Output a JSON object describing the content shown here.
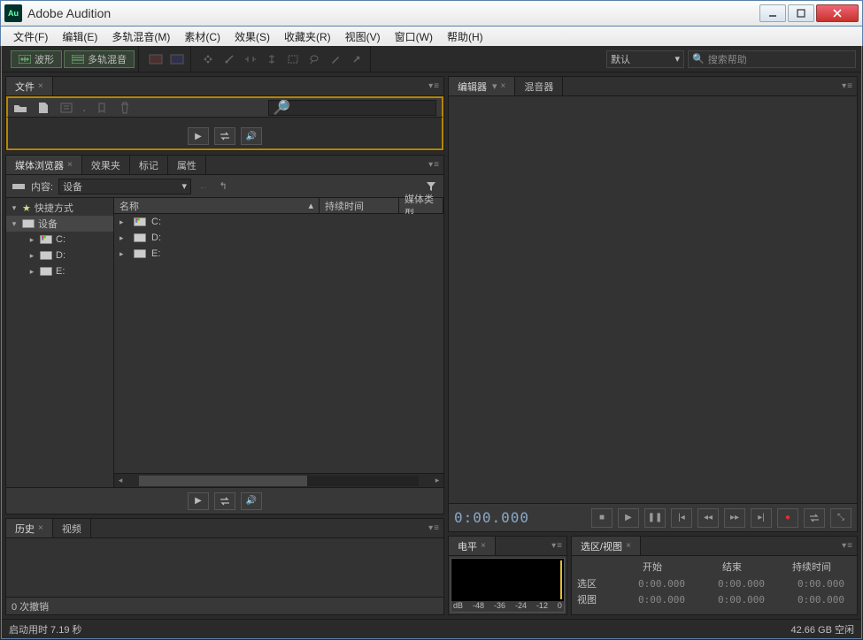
{
  "titlebar": {
    "title": "Adobe Audition",
    "icon_text": "Au"
  },
  "menu": [
    "文件(F)",
    "编辑(E)",
    "多轨混音(M)",
    "素材(C)",
    "效果(S)",
    "收藏夹(R)",
    "视图(V)",
    "窗口(W)",
    "帮助(H)"
  ],
  "toolbar": {
    "waveform": "波形",
    "multitrack": "多轨混音",
    "workspace_label": "默认",
    "search_placeholder": "搜索帮助"
  },
  "panels": {
    "files": {
      "tab": "文件"
    },
    "media": {
      "tabs": [
        "媒体浏览器",
        "效果夹",
        "标记",
        "属性"
      ],
      "content_label": "内容:",
      "content_value": "设备",
      "tree_shortcuts": "快捷方式",
      "tree_devices": "设备",
      "drives": [
        "C:",
        "D:",
        "E:"
      ],
      "columns": {
        "name": "名称",
        "duration": "持续时间",
        "type": "媒体类型"
      }
    },
    "history": {
      "tabs": [
        "历史",
        "视频"
      ],
      "undo_text": "0 次撤销"
    },
    "editor": {
      "tabs": [
        "编辑器",
        "混音器"
      ],
      "timecode": "0:00.000"
    },
    "levels": {
      "tab": "电平",
      "scale": [
        "dB",
        "-48",
        "-36",
        "-24",
        "-12",
        "0"
      ]
    },
    "selview": {
      "tab": "选区/视图",
      "cols": [
        "开始",
        "结束",
        "持续时间"
      ],
      "rows": [
        {
          "label": "选区",
          "start": "0:00.000",
          "end": "0:00.000",
          "dur": "0:00.000"
        },
        {
          "label": "视图",
          "start": "0:00.000",
          "end": "0:00.000",
          "dur": "0:00.000"
        }
      ]
    }
  },
  "status": {
    "left": "启动用时  7.19 秒",
    "right": "42.66 GB 空闲"
  }
}
